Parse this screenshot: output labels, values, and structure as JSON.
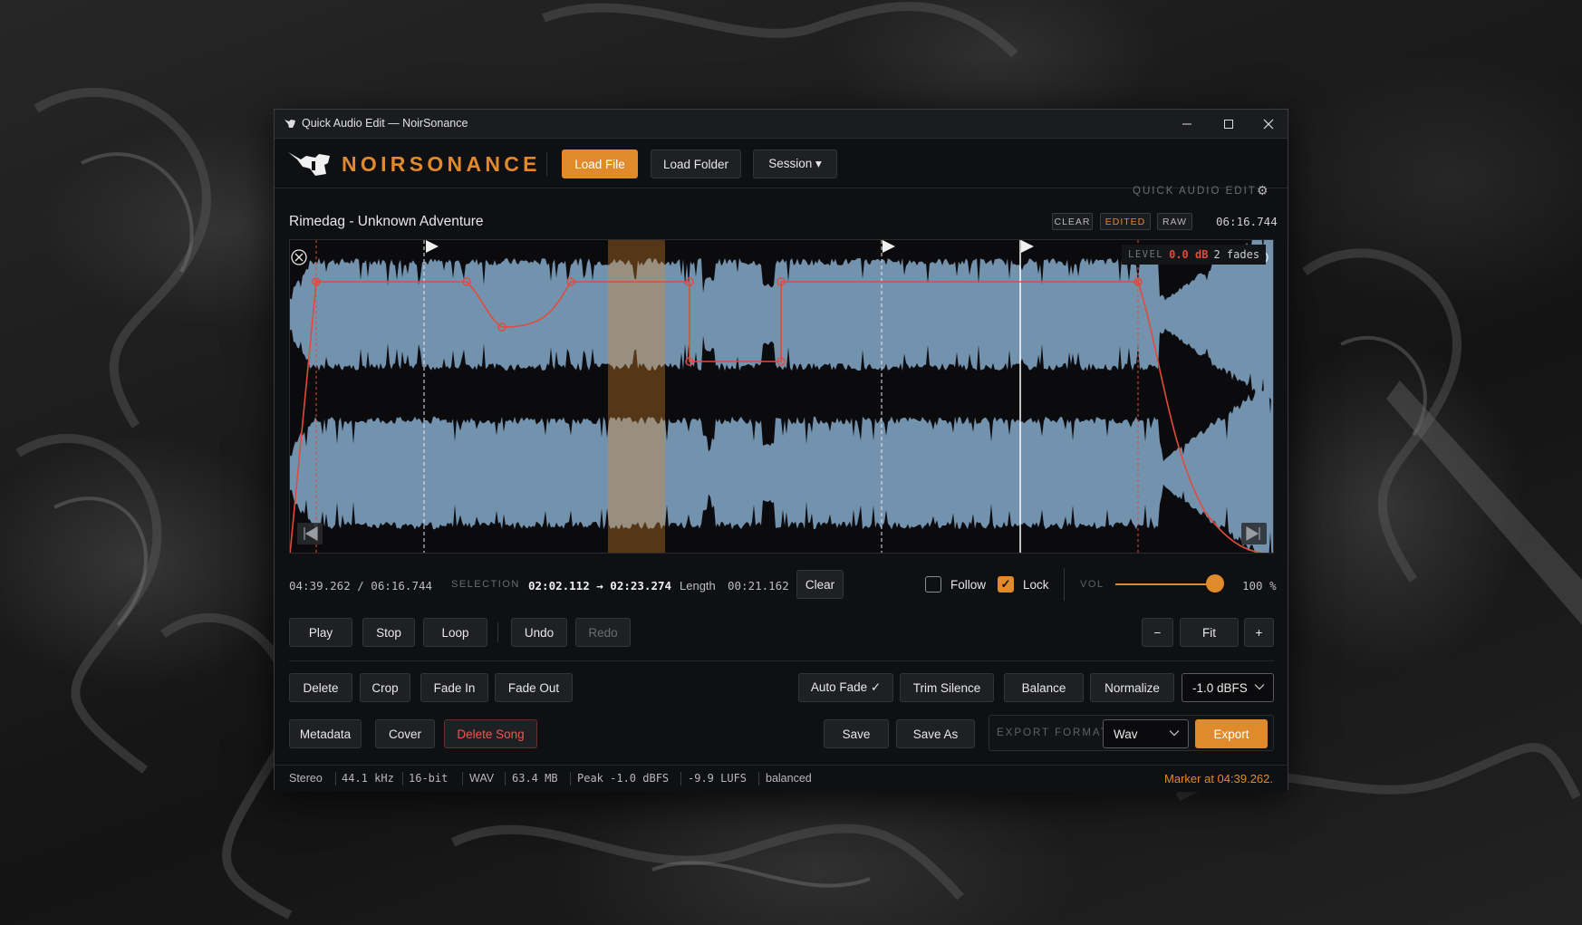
{
  "window": {
    "title": "Quick Audio Edit — NoirSonance",
    "minimize_icon": "minimize-icon",
    "maximize_icon": "maximize-icon",
    "close_icon": "close-icon"
  },
  "header": {
    "brand": "NOIRSONANCE",
    "load_file": "Load File",
    "load_folder": "Load Folder",
    "session": "Session ▾",
    "mode_label": "QUICK AUDIO EDIT",
    "settings_icon": "gear-icon"
  },
  "track": {
    "title": "Rimedag - Unknown Adventure",
    "badges": [
      "CLEAR",
      "EDITED",
      "RAW"
    ],
    "duration": "06:16.744"
  },
  "waveform": {
    "level_label": "LEVEL",
    "level_value": "0.0 dB",
    "fades": "2 fades",
    "selection_start": "02:02.112",
    "selection_end": "02:23.274",
    "playhead": "04:39.262"
  },
  "transport": {
    "position": "04:39.262 / 06:16.744",
    "selection_label": "SELECTION",
    "selection_range": "02:02.112 → 02:23.274",
    "length_label": "Length",
    "length_value": "00:21.162",
    "clear": "Clear",
    "follow_label": "Follow",
    "follow_checked": false,
    "lock_label": "Lock",
    "lock_checked": true,
    "vol_label": "VOL",
    "vol_value": "100 %",
    "vol_percent": 100
  },
  "controls": {
    "play": "Play",
    "stop": "Stop",
    "loop": "Loop",
    "undo": "Undo",
    "redo": "Redo",
    "zoom_out": "−",
    "fit": "Fit",
    "zoom_in": "+"
  },
  "edit": {
    "delete": "Delete",
    "crop": "Crop",
    "fade_in": "Fade In",
    "fade_out": "Fade Out",
    "auto_fade": "Auto Fade ✓",
    "trim_silence": "Trim Silence",
    "balance": "Balance",
    "normalize": "Normalize",
    "normalize_target": "-1.0 dBFS"
  },
  "file": {
    "metadata": "Metadata",
    "cover": "Cover",
    "delete_song": "Delete Song",
    "save": "Save",
    "save_as": "Save As",
    "export_format_label": "EXPORT FORMAT",
    "export_format": "Wav",
    "export": "Export"
  },
  "status": {
    "items": [
      "Stereo",
      "44.1 kHz",
      "16-bit",
      "WAV",
      "63.4 MB",
      "Peak -1.0 dBFS",
      "-9.9 LUFS",
      "balanced"
    ],
    "message": "Marker at 04:39.262."
  },
  "colors": {
    "accent": "#e08a2c",
    "waveform": "#7392ae",
    "envelope": "#e04b3c"
  }
}
